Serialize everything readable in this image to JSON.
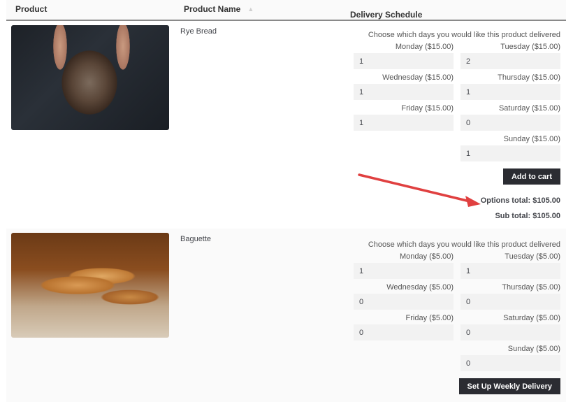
{
  "table": {
    "headers": {
      "product": "Product",
      "product_name": "Product Name",
      "sort_icon": "sort-icon",
      "delivery_schedule": "Delivery Schedule"
    }
  },
  "products": [
    {
      "name": "Rye Bread",
      "image": "rye-bread-image",
      "intro": "Choose which days you would like this product delivered",
      "days": [
        {
          "label": "Monday ($15.00)",
          "value": "1"
        },
        {
          "label": "Tuesday ($15.00)",
          "value": "2"
        },
        {
          "label": "Wednesday ($15.00)",
          "value": "1"
        },
        {
          "label": "Thursday ($15.00)",
          "value": "1"
        },
        {
          "label": "Friday ($15.00)",
          "value": "1"
        },
        {
          "label": "Saturday ($15.00)",
          "value": "0"
        },
        {
          "label": "Sunday ($15.00)",
          "value": "1"
        }
      ],
      "button": "Add to cart",
      "options_total": "Options total: $105.00",
      "sub_total": "Sub total: $105.00"
    },
    {
      "name": "Baguette",
      "image": "baguette-image",
      "intro": "Choose which days you would like this product delivered",
      "days": [
        {
          "label": "Monday ($5.00)",
          "value": "1"
        },
        {
          "label": "Tuesday ($5.00)",
          "value": "1"
        },
        {
          "label": "Wednesday ($5.00)",
          "value": "0"
        },
        {
          "label": "Thursday ($5.00)",
          "value": "0"
        },
        {
          "label": "Friday ($5.00)",
          "value": "0"
        },
        {
          "label": "Saturday ($5.00)",
          "value": "0"
        },
        {
          "label": "Sunday ($5.00)",
          "value": "0"
        }
      ],
      "button": "Set Up Weekly Delivery"
    }
  ],
  "annotation": {
    "type": "arrow",
    "color": "#e04040",
    "points_to": "Options total"
  },
  "colors": {
    "button_bg": "#2b2c32",
    "input_bg": "#f2f2f2",
    "alt_row_bg": "#fafafa"
  }
}
